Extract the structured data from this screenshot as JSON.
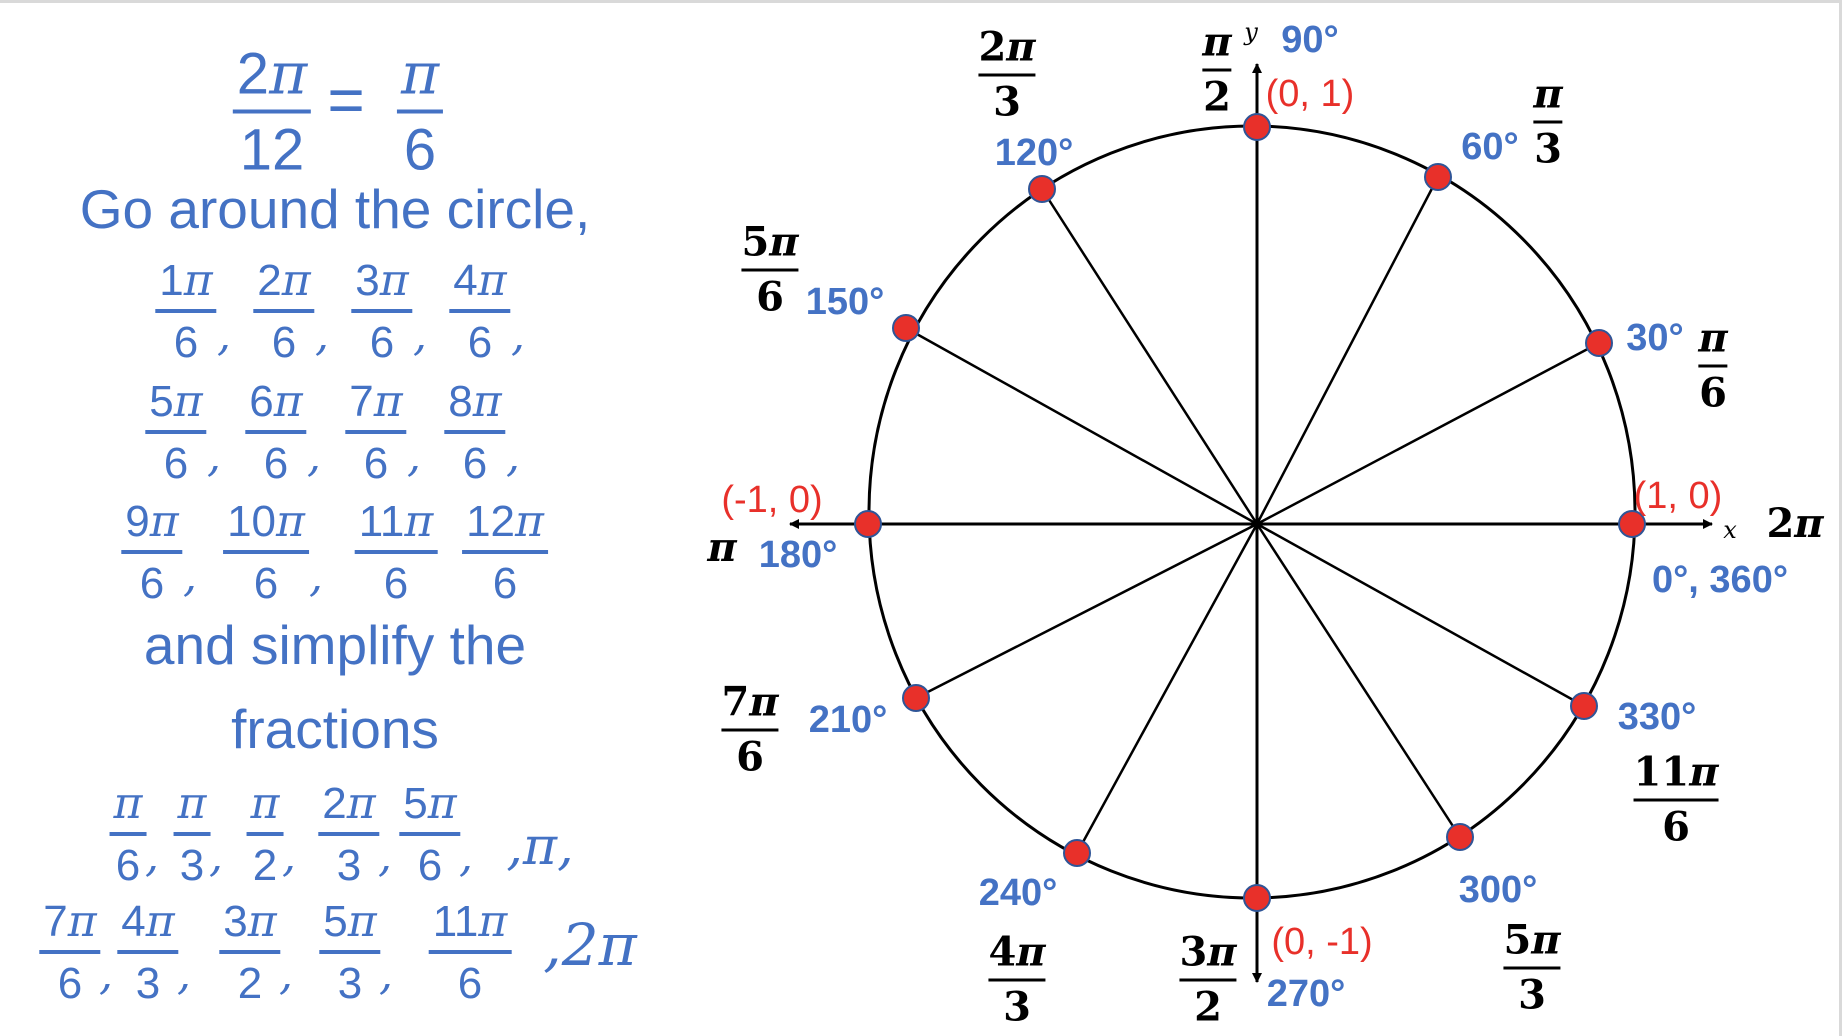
{
  "left_panel": {
    "header_equation": {
      "lhs": {
        "num": "2",
        "sym": "π",
        "den": "12"
      },
      "equals": "=",
      "rhs": {
        "num": "",
        "sym": "π",
        "den": "6"
      }
    },
    "instruction_1": "Go around the circle,",
    "twelfths_rows": [
      {
        "items": [
          {
            "num": "1",
            "sym": "π",
            "den": "6",
            "sep": ","
          },
          {
            "num": "2",
            "sym": "π",
            "den": "6",
            "sep": ","
          },
          {
            "num": "3",
            "sym": "π",
            "den": "6",
            "sep": ","
          },
          {
            "num": "4",
            "sym": "π",
            "den": "6",
            "sep": ","
          }
        ]
      },
      {
        "items": [
          {
            "num": "5",
            "sym": "π",
            "den": "6",
            "sep": ","
          },
          {
            "num": "6",
            "sym": "π",
            "den": "6",
            "sep": ","
          },
          {
            "num": "7",
            "sym": "π",
            "den": "6",
            "sep": ","
          },
          {
            "num": "8",
            "sym": "π",
            "den": "6",
            "sep": ","
          }
        ]
      },
      {
        "items": [
          {
            "num": "9",
            "sym": "π",
            "den": "6",
            "sep": ","
          },
          {
            "num": "10",
            "sym": "π",
            "den": "6",
            "sep": ","
          },
          {
            "num": "11",
            "sym": "π",
            "den": "6",
            "sep": ""
          },
          {
            "num": "12",
            "sym": "π",
            "den": "6",
            "sep": ""
          }
        ]
      }
    ],
    "instruction_2_line1": "and simplify the",
    "instruction_2_line2": "fractions",
    "simplified_rows": [
      {
        "items": [
          {
            "num": "",
            "sym": "π",
            "den": "6",
            "sep": ","
          },
          {
            "num": "",
            "sym": "π",
            "den": "3",
            "sep": ","
          },
          {
            "num": "",
            "sym": "π",
            "den": "2",
            "sep": ","
          },
          {
            "num": "2",
            "sym": "π",
            "den": "3",
            "sep": ","
          },
          {
            "num": "5",
            "sym": "π",
            "den": "6",
            "sep": ","
          }
        ],
        "tail": ",π,"
      },
      {
        "items": [
          {
            "num": "7",
            "sym": "π",
            "den": "6",
            "sep": ","
          },
          {
            "num": "4",
            "sym": "π",
            "den": "3",
            "sep": ","
          },
          {
            "num": "3",
            "sym": "π",
            "den": "2",
            "sep": ","
          },
          {
            "num": "5",
            "sym": "π",
            "den": "3",
            "sep": ","
          },
          {
            "num": "11",
            "sym": "π",
            "den": "6",
            "sep": ""
          }
        ],
        "tail": ",2π"
      }
    ]
  },
  "unit_circle": {
    "colors": {
      "degree_text": "#4472C4",
      "coordinate_text": "#E8302A",
      "point_fill": "#E8302A",
      "point_outline": "#2F5597",
      "lines": "#000000"
    },
    "axis_labels": {
      "x": "x",
      "y": "y"
    },
    "points": [
      {
        "angle_deg": 0,
        "degree_label": "0°, 360°",
        "radian": {
          "num": "2",
          "sym": "π",
          "den": ""
        },
        "coordinate": "(1, 0)"
      },
      {
        "angle_deg": 30,
        "degree_label": "30°",
        "radian": {
          "num": "",
          "sym": "π",
          "den": "6"
        },
        "coordinate": ""
      },
      {
        "angle_deg": 60,
        "degree_label": "60°",
        "radian": {
          "num": "",
          "sym": "π",
          "den": "3"
        },
        "coordinate": ""
      },
      {
        "angle_deg": 90,
        "degree_label": "90°",
        "radian": {
          "num": "",
          "sym": "π",
          "den": "2"
        },
        "coordinate": "(0, 1)"
      },
      {
        "angle_deg": 120,
        "degree_label": "120°",
        "radian": {
          "num": "2",
          "sym": "π",
          "den": "3"
        },
        "coordinate": ""
      },
      {
        "angle_deg": 150,
        "degree_label": "150°",
        "radian": {
          "num": "5",
          "sym": "π",
          "den": "6"
        },
        "coordinate": ""
      },
      {
        "angle_deg": 180,
        "degree_label": "180°",
        "radian": {
          "num": "",
          "sym": "π",
          "den": ""
        },
        "coordinate": "(-1, 0)"
      },
      {
        "angle_deg": 210,
        "degree_label": "210°",
        "radian": {
          "num": "7",
          "sym": "π",
          "den": "6"
        },
        "coordinate": ""
      },
      {
        "angle_deg": 240,
        "degree_label": "240°",
        "radian": {
          "num": "4",
          "sym": "π",
          "den": "3"
        },
        "coordinate": ""
      },
      {
        "angle_deg": 270,
        "degree_label": "270°",
        "radian": {
          "num": "3",
          "sym": "π",
          "den": "2"
        },
        "coordinate": "(0, -1)"
      },
      {
        "angle_deg": 300,
        "degree_label": "300°",
        "radian": {
          "num": "5",
          "sym": "π",
          "den": "3"
        },
        "coordinate": ""
      },
      {
        "angle_deg": 330,
        "degree_label": "330°",
        "radian": {
          "num": "11",
          "sym": "π",
          "den": "6"
        },
        "coordinate": ""
      }
    ]
  }
}
